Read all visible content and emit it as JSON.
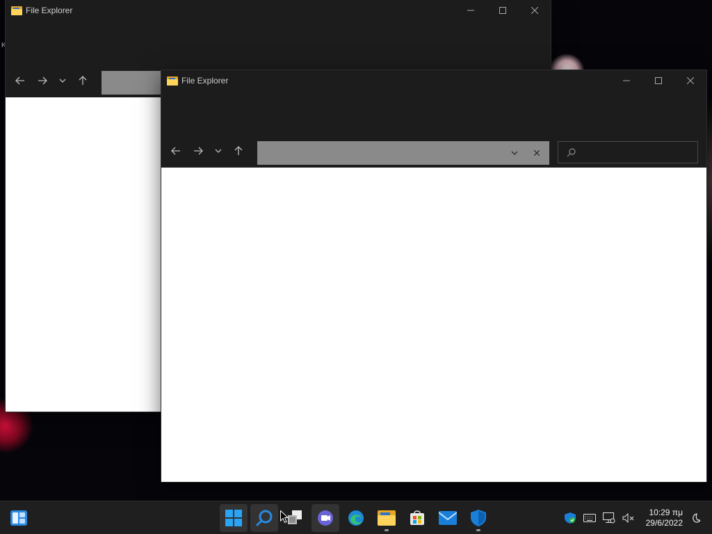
{
  "windows": {
    "back": {
      "title": "File Explorer"
    },
    "front": {
      "title": "File Explorer",
      "search": {
        "value": "",
        "placeholder": ""
      },
      "address": {
        "value": ""
      }
    }
  },
  "desktop": {
    "stray_text": "K"
  },
  "taskbar": {
    "pinned": [
      {
        "name": "start",
        "icon": "windows-logo-icon",
        "active": true
      },
      {
        "name": "search",
        "icon": "search-icon",
        "active": true
      },
      {
        "name": "task-view",
        "icon": "task-view-icon",
        "active": false
      },
      {
        "name": "chat",
        "icon": "chat-icon",
        "active": true
      },
      {
        "name": "edge",
        "icon": "edge-icon",
        "active": false
      },
      {
        "name": "file-explorer",
        "icon": "folder-icon",
        "active": false,
        "running": true
      },
      {
        "name": "store",
        "icon": "store-icon",
        "active": false
      },
      {
        "name": "mail",
        "icon": "mail-icon",
        "active": false
      },
      {
        "name": "security",
        "icon": "shield-icon",
        "active": false,
        "running": true
      }
    ],
    "clock": {
      "time": "10:29 πμ",
      "date": "29/6/2022"
    }
  },
  "colors": {
    "taskbar": "#1f1f1f",
    "window_chrome": "#1c1c1c",
    "address_bar": "#8a8a8a",
    "accent": "#0078d4"
  }
}
